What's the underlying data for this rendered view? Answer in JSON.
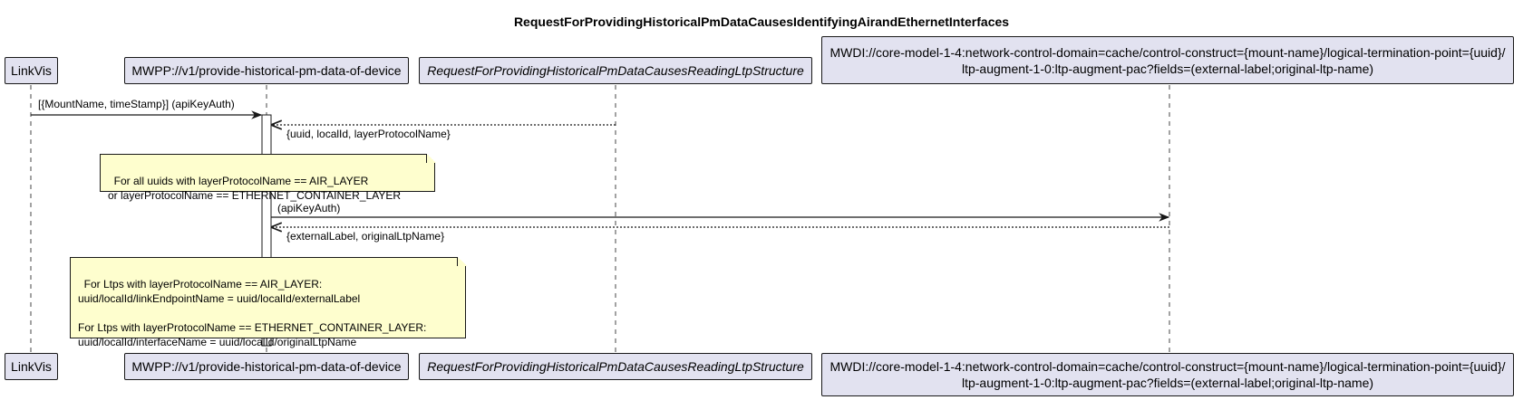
{
  "title": "RequestForProvidingHistoricalPmDataCausesIdentifyingAirandEthernetInterfaces",
  "participants": [
    {
      "name": "LinkVis"
    },
    {
      "name": "MWPP://v1/provide-historical-pm-data-of-device"
    },
    {
      "name": "RequestForProvidingHistoricalPmDataCausesReadingLtpStructure"
    },
    {
      "line1": "MWDI://core-model-1-4:network-control-domain=cache/control-construct={mount-name}/logical-termination-point={uuid}/",
      "line2": "ltp-augment-1-0:ltp-augment-pac?fields=(external-label;original-ltp-name)"
    }
  ],
  "messages": [
    {
      "label": "[{MountName, timeStamp}] (apiKeyAuth)"
    },
    {
      "label": "{uuid, localId, layerProtocolName}"
    },
    {
      "label": "(apiKeyAuth)"
    },
    {
      "label": "{externalLabel, originalLtpName}"
    }
  ],
  "notes": [
    {
      "text": "For all uuids with layerProtocolName == AIR_LAYER\nor layerProtocolName == ETHERNET_CONTAINER_LAYER"
    },
    {
      "text": "For Ltps with layerProtocolName == AIR_LAYER:\nuuid/localId/linkEndpointName = uuid/localId/externalLabel\n\nFor Ltps with layerProtocolName == ETHERNET_CONTAINER_LAYER:\nuuid/localId/interfaceName = uuid/localId/originalLtpName"
    }
  ]
}
